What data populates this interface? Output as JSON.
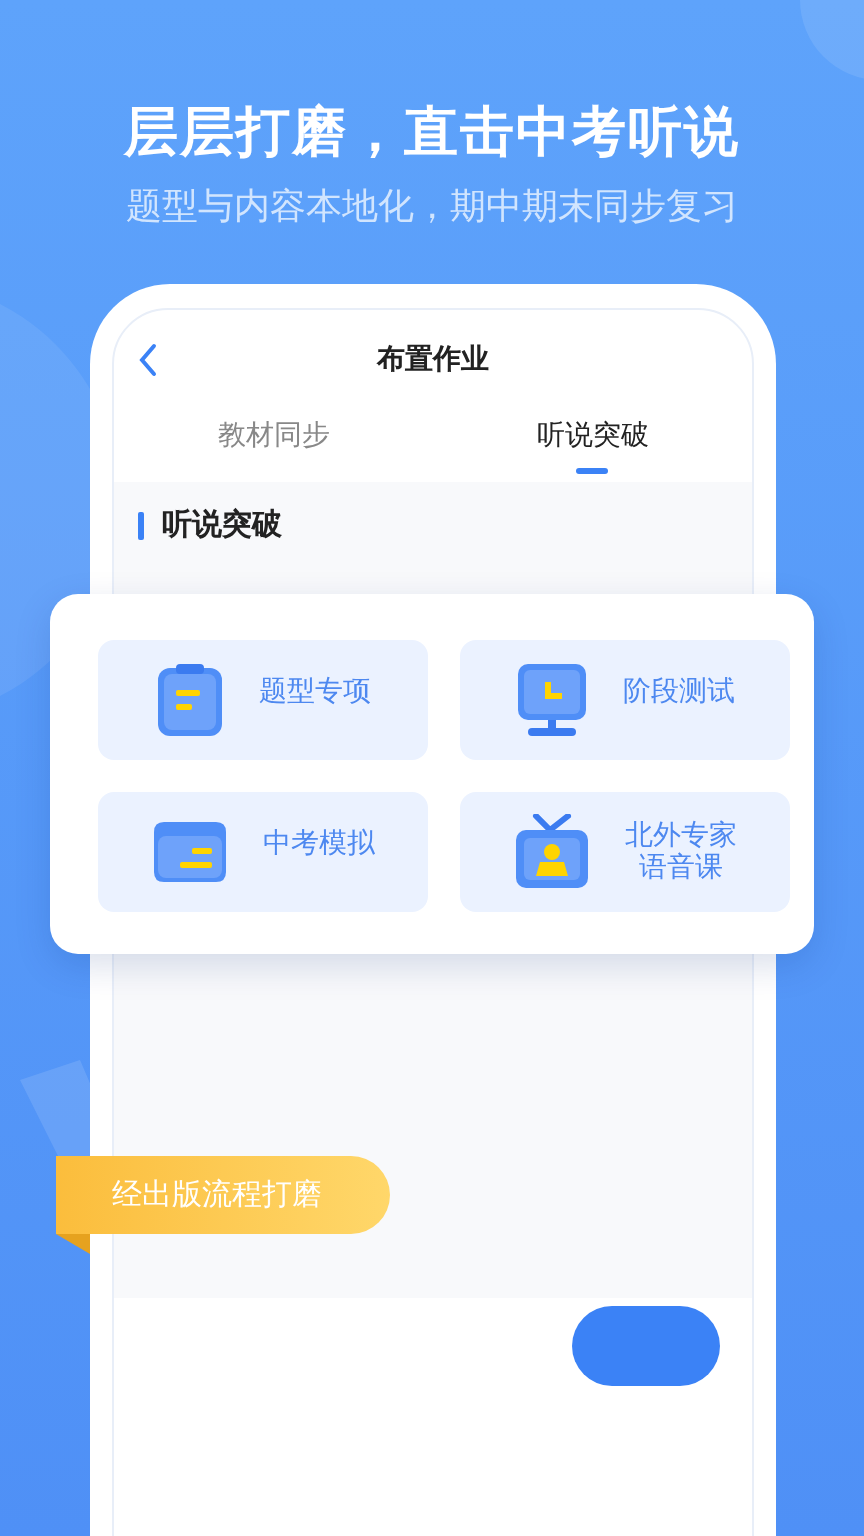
{
  "headline": "层层打磨，直击中考听说",
  "subtitle": "题型与内容本地化，期中期末同步复习",
  "screen": {
    "title": "布置作业",
    "tabs": [
      {
        "label": "教材同步",
        "selected": false
      },
      {
        "label": "听说突破",
        "selected": true
      }
    ],
    "section_title": "听说突破"
  },
  "popup": {
    "tiles": [
      {
        "label": "题型专项",
        "kind": "clipboard"
      },
      {
        "label": "阶段测试",
        "kind": "monitor"
      },
      {
        "label": "中考模拟",
        "kind": "folder"
      },
      {
        "label": "北外专家语音课",
        "kind": "tv"
      }
    ]
  },
  "ribbon": "经出版流程打磨"
}
